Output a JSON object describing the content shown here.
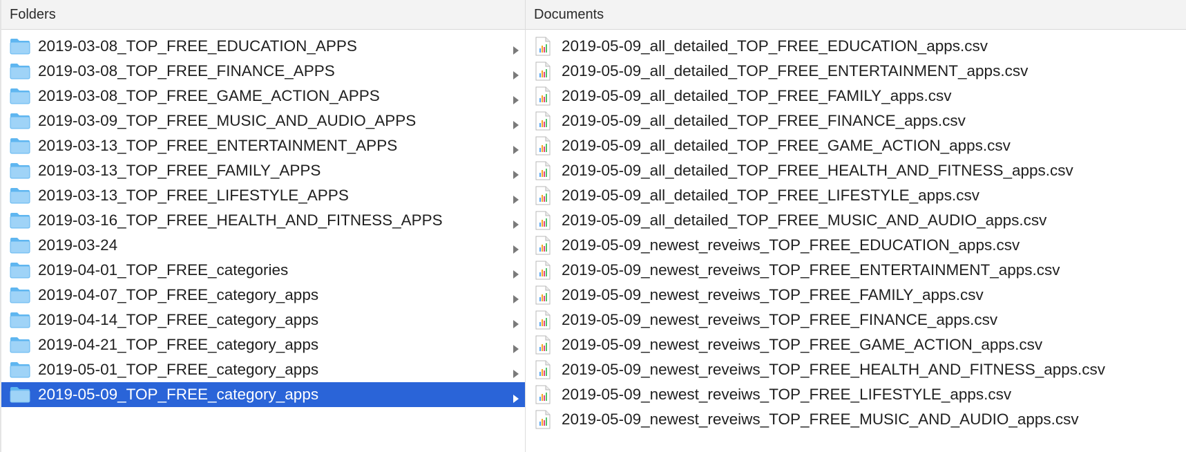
{
  "folders_pane": {
    "header": "Folders",
    "items": [
      {
        "label": "2019-03-08_TOP_FREE_EDUCATION_APPS",
        "selected": false
      },
      {
        "label": "2019-03-08_TOP_FREE_FINANCE_APPS",
        "selected": false
      },
      {
        "label": "2019-03-08_TOP_FREE_GAME_ACTION_APPS",
        "selected": false
      },
      {
        "label": "2019-03-09_TOP_FREE_MUSIC_AND_AUDIO_APPS",
        "selected": false
      },
      {
        "label": "2019-03-13_TOP_FREE_ENTERTAINMENT_APPS",
        "selected": false
      },
      {
        "label": "2019-03-13_TOP_FREE_FAMILY_APPS",
        "selected": false
      },
      {
        "label": "2019-03-13_TOP_FREE_LIFESTYLE_APPS",
        "selected": false
      },
      {
        "label": "2019-03-16_TOP_FREE_HEALTH_AND_FITNESS_APPS",
        "selected": false
      },
      {
        "label": "2019-03-24",
        "selected": false
      },
      {
        "label": "2019-04-01_TOP_FREE_categories",
        "selected": false
      },
      {
        "label": "2019-04-07_TOP_FREE_category_apps",
        "selected": false
      },
      {
        "label": "2019-04-14_TOP_FREE_category_apps",
        "selected": false
      },
      {
        "label": "2019-04-21_TOP_FREE_category_apps",
        "selected": false
      },
      {
        "label": "2019-05-01_TOP_FREE_category_apps",
        "selected": false
      },
      {
        "label": "2019-05-09_TOP_FREE_category_apps",
        "selected": true
      }
    ]
  },
  "documents_pane": {
    "header": "Documents",
    "items": [
      "2019-05-09_all_detailed_TOP_FREE_EDUCATION_apps.csv",
      "2019-05-09_all_detailed_TOP_FREE_ENTERTAINMENT_apps.csv",
      "2019-05-09_all_detailed_TOP_FREE_FAMILY_apps.csv",
      "2019-05-09_all_detailed_TOP_FREE_FINANCE_apps.csv",
      "2019-05-09_all_detailed_TOP_FREE_GAME_ACTION_apps.csv",
      "2019-05-09_all_detailed_TOP_FREE_HEALTH_AND_FITNESS_apps.csv",
      "2019-05-09_all_detailed_TOP_FREE_LIFESTYLE_apps.csv",
      "2019-05-09_all_detailed_TOP_FREE_MUSIC_AND_AUDIO_apps.csv",
      "2019-05-09_newest_reveiws_TOP_FREE_EDUCATION_apps.csv",
      "2019-05-09_newest_reveiws_TOP_FREE_ENTERTAINMENT_apps.csv",
      "2019-05-09_newest_reveiws_TOP_FREE_FAMILY_apps.csv",
      "2019-05-09_newest_reveiws_TOP_FREE_FINANCE_apps.csv",
      "2019-05-09_newest_reveiws_TOP_FREE_GAME_ACTION_apps.csv",
      "2019-05-09_newest_reveiws_TOP_FREE_HEALTH_AND_FITNESS_apps.csv",
      "2019-05-09_newest_reveiws_TOP_FREE_LIFESTYLE_apps.csv",
      "2019-05-09_newest_reveiws_TOP_FREE_MUSIC_AND_AUDIO_apps.csv"
    ]
  },
  "icons": {
    "folder": "folder-icon",
    "chevron": "chevron-right-icon",
    "document": "csv-document-icon"
  },
  "colors": {
    "selection": "#2a64d8",
    "folder_light": "#9fd3f7",
    "folder_dark": "#5fb6f0"
  }
}
